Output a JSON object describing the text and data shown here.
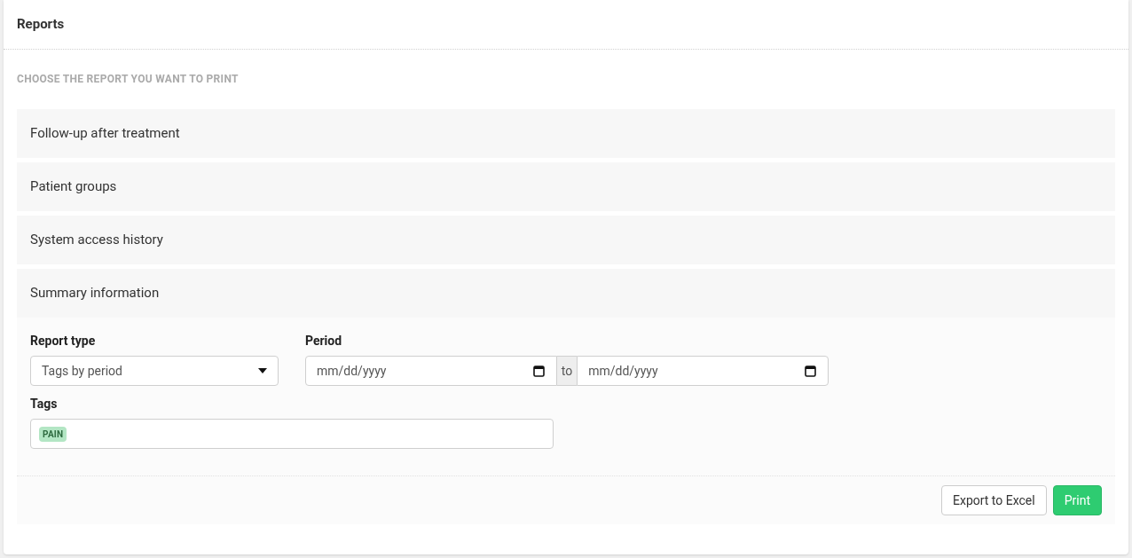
{
  "title": "Reports",
  "section_label": "CHOOSE THE REPORT YOU WANT TO PRINT",
  "reports": [
    {
      "title": "Follow-up after treatment",
      "expanded": false
    },
    {
      "title": "Patient groups",
      "expanded": false
    },
    {
      "title": "System access history",
      "expanded": false
    },
    {
      "title": "Summary information",
      "expanded": true
    }
  ],
  "form": {
    "report_type": {
      "label": "Report type",
      "value": "Tags by period"
    },
    "period": {
      "label": "Period",
      "from_placeholder": "mm/dd/yyyy",
      "separator": "to",
      "to_placeholder": "mm/dd/yyyy"
    },
    "tags": {
      "label": "Tags",
      "items": [
        {
          "text": "PAIN",
          "color": "#b3e6c4"
        }
      ]
    }
  },
  "buttons": [
    {
      "label": "Export to Excel",
      "kind": "secondary"
    },
    {
      "label": "Print",
      "kind": "primary"
    }
  ]
}
